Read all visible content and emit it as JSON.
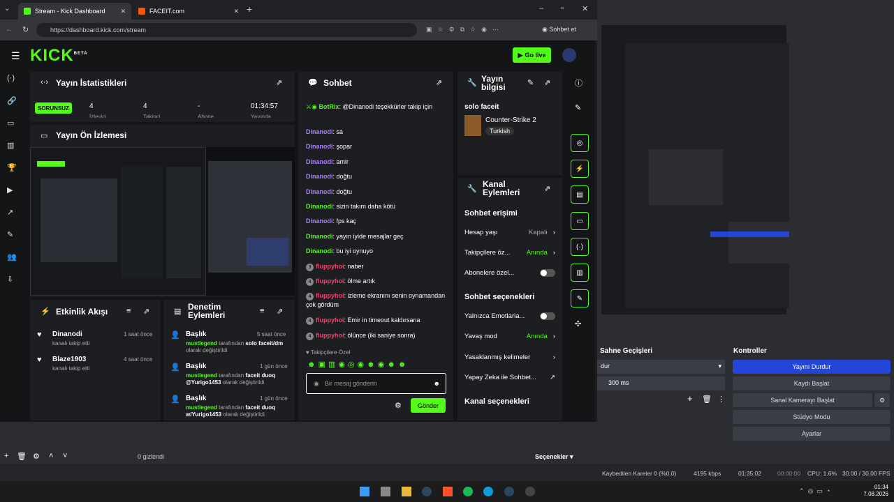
{
  "browser": {
    "tabs": [
      {
        "label": "Stream - Kick Dashboard"
      },
      {
        "label": "FACEIT.com"
      }
    ],
    "url": "https://dashboard.kick.com/stream",
    "copilot_label": "Sohbet et"
  },
  "header": {
    "logo": "KICK",
    "logo_beta": "BETA",
    "golive_label": "Go live"
  },
  "stats": {
    "title": "Yayın İstatistikleri",
    "status_badge": "SORUNSUZ",
    "values": [
      "4",
      "4",
      "-",
      "01:34:57"
    ],
    "labels": [
      "İzleyici",
      "Takipçi",
      "Abone",
      "Yayında"
    ]
  },
  "preview": {
    "title": "Yayın Ön İzlemesi"
  },
  "activity": {
    "title": "Etkinlik Akışı",
    "items": [
      {
        "name": "Dinanodi",
        "desc": "kanalı takip etti",
        "time": "1 saat önce"
      },
      {
        "name": "Blaze1903",
        "desc": "kanalı takip etti",
        "time": "4 saat önce"
      }
    ]
  },
  "moderation": {
    "title": "Denetim Eylemleri",
    "items": [
      {
        "heading": "Başlık",
        "time": "5 saat önce",
        "user": "mustlegend",
        "text": "tarafından",
        "value": "solo faceit/dm",
        "suffix": "olarak değiştirildi"
      },
      {
        "heading": "Başlık",
        "time": "1 gün önce",
        "user": "mustlegend",
        "text": "tarafından",
        "value": "faceit duoq @Yurigo1453",
        "suffix": "olarak değiştirildi"
      },
      {
        "heading": "Başlık",
        "time": "1 gün önce",
        "user": "mustlegend",
        "text": "tarafından",
        "value": "faceit duoq w/Yurigo1453",
        "suffix": "olarak değiştirildi"
      }
    ]
  },
  "chat": {
    "title": "Sohbet",
    "messages": [
      {
        "user": "BotRix",
        "color": "g",
        "text": ": @Dinanodi teşekkürler takip için"
      },
      {
        "user": "Dinanodi",
        "color": "p",
        "text": ": sa"
      },
      {
        "user": "Dinanodi",
        "color": "p",
        "text": ": şopar"
      },
      {
        "user": "Dinanodi",
        "color": "p",
        "text": ": amir"
      },
      {
        "user": "Dinanodi",
        "color": "p",
        "text": ": doğtu"
      },
      {
        "user": "Dinanodi",
        "color": "p",
        "text": ": doğtu"
      },
      {
        "user": "Dinanodi",
        "color": "g",
        "text": ": sizin takım daha kötü"
      },
      {
        "user": "Dinanodi",
        "color": "p",
        "text": ": fps kaç"
      },
      {
        "user": "Dinanodi",
        "color": "g",
        "text": ": yayın iyide mesajlar geç"
      },
      {
        "user": "Dinanodi",
        "color": "g",
        "text": ": bu iyi oynuyo"
      },
      {
        "user": "fluppyhoi",
        "color": "r",
        "badge": "3",
        "text": ": naber"
      },
      {
        "user": "fluppyhoi",
        "color": "r",
        "badge": "4",
        "text": ": ölme artık"
      },
      {
        "user": "fluppyhoi",
        "color": "r",
        "badge": "4",
        "text": ": izleme ekranını senin oynamandan çok gördüm"
      },
      {
        "user": "fluppyhoi",
        "color": "r",
        "badge": "4",
        "text": ": Emir in timeout kaldırsana"
      },
      {
        "user": "fluppyhoi",
        "color": "r",
        "badge": "4",
        "text": ": ölünce (iki saniye sonra)"
      }
    ],
    "followers_only": "Takipçilere Özel",
    "input_placeholder": "Bir mesaj gönderin",
    "send_label": "Gönder"
  },
  "stream_info": {
    "title": "Yayın bilgisi",
    "stream_title": "solo faceit",
    "category": "Counter-Strike 2",
    "language": "Turkish"
  },
  "channel_actions": {
    "title": "Kanal Eylemleri",
    "section1": "Sohbet erişimi",
    "rows1": [
      {
        "label": "Hesap yaşı",
        "value": "Kapalı"
      },
      {
        "label": "Takipçilere öz...",
        "value": "Anında"
      },
      {
        "label": "Abonelere özel...",
        "value": ""
      }
    ],
    "section2": "Sohbet seçenekleri",
    "rows2": [
      {
        "label": "Yalnızca Emotlaria...",
        "value": ""
      },
      {
        "label": "Yavaş mod",
        "value": "Anında"
      },
      {
        "label": "Yasaklanmış kelimeler",
        "value": ""
      },
      {
        "label": "Yapay Zeka ile Sohbet...",
        "value": ""
      }
    ],
    "section3": "Kanal seçenekleri"
  },
  "obs": {
    "transitions_title": "Sahne Geçişleri",
    "transition_value": "dur",
    "duration": "300 ms",
    "controls_title": "Kontroller",
    "buttons": [
      "Yayını Durdur",
      "Kaydı Başlat",
      "Sanal Kamerayı Başlat",
      "Stüdyo Modu",
      "Ayarlar"
    ],
    "hidden_count": "0 gizlendi",
    "options_label": "Seçenekler"
  },
  "status": {
    "dropped": "Kaybedilen Kareler 0 (%0.0)",
    "bitrate": "4195 kbps",
    "live_time": "01:35:02",
    "rec_time": "00:00:00",
    "cpu": "CPU: 1.6%",
    "fps": "30.00 / 30.00 FPS"
  },
  "clock": {
    "time": "01:34",
    "date": "7.08.2026"
  }
}
